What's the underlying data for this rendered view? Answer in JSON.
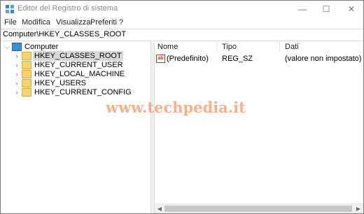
{
  "window": {
    "title": "Editor del Registro di sistema",
    "controls": {
      "minimize": "—",
      "maximize": "☐",
      "close": "✕"
    },
    "icon": "regedit-icon"
  },
  "menu": [
    "File",
    "Modifica",
    "Visualizza",
    "Preferiti",
    "?"
  ],
  "address": "Computer\\HKEY_CLASSES_ROOT",
  "tree": {
    "root": {
      "label": "Computer",
      "icon": "computer-icon",
      "expanded": true
    },
    "children": [
      {
        "label": "HKEY_CLASSES_ROOT",
        "selected": true
      },
      {
        "label": "HKEY_CURRENT_USER",
        "selected": false
      },
      {
        "label": "HKEY_LOCAL_MACHINE",
        "selected": false
      },
      {
        "label": "HKEY_USERS",
        "selected": false
      },
      {
        "label": "HKEY_CURRENT_CONFIG",
        "selected": false
      }
    ]
  },
  "list": {
    "columns": [
      "Nome",
      "Tipo",
      "Dati"
    ],
    "rows": [
      {
        "icon": "ab",
        "name": "(Predefinito)",
        "type": "REG_SZ",
        "data": "(valore non impostato)"
      }
    ]
  },
  "watermark": "www.techpedia.it",
  "colors": {
    "selection": "#d9d9d9",
    "folder": "#f6d36e",
    "watermark": "#f3a27a"
  }
}
